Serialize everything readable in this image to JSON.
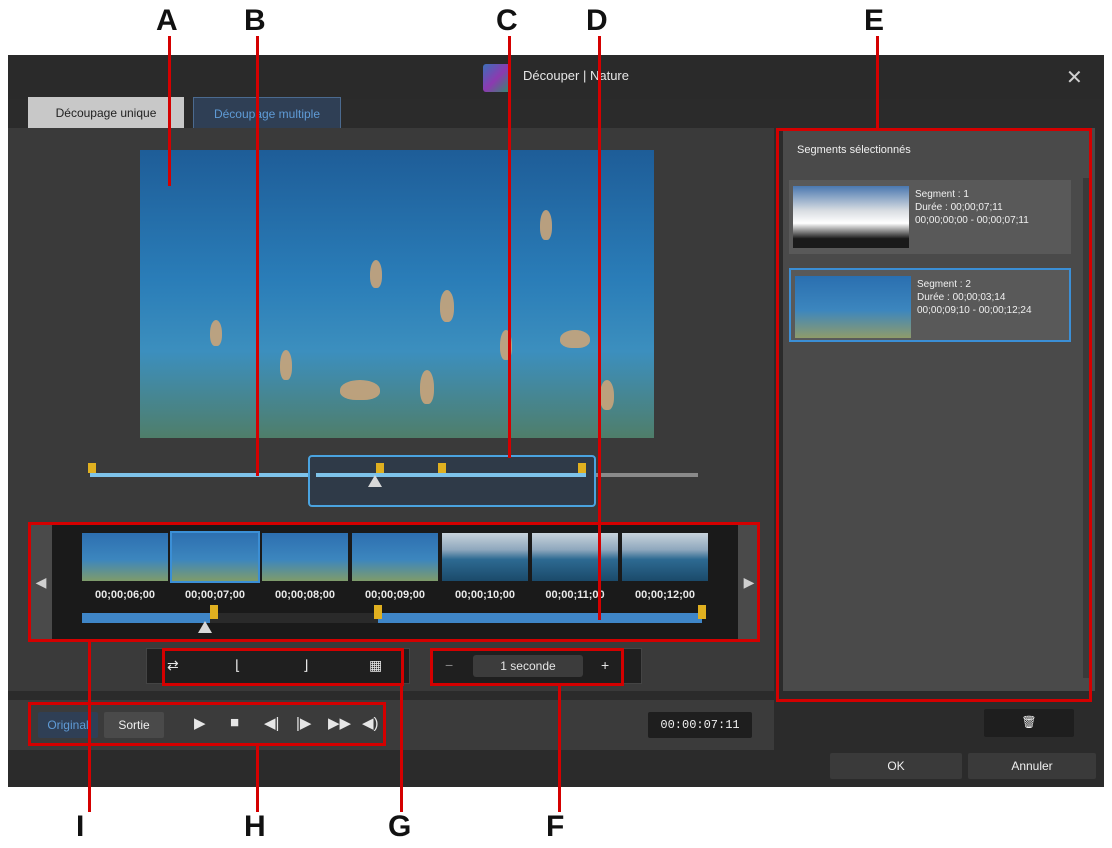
{
  "callouts": {
    "A": "A",
    "B": "B",
    "C": "C",
    "D": "D",
    "E": "E",
    "F": "F",
    "G": "G",
    "H": "H",
    "I": "I"
  },
  "window": {
    "title": "Découper | Nature",
    "close_glyph": "✕"
  },
  "tabs": [
    {
      "label": "Découpage unique",
      "active": true
    },
    {
      "label": "Découpage multiple",
      "active": false
    }
  ],
  "filmstrip": {
    "timecodes": [
      "00;00;06;00",
      "00;00;07;00",
      "00;00;08;00",
      "00;00;09;00",
      "00;00;10;00",
      "00;00;11;00",
      "00;00;12;00"
    ],
    "prev_glyph": "◀",
    "next_glyph": "▶"
  },
  "toolbar": {
    "icons": [
      "swap-in-out-icon",
      "mark-in-icon",
      "mark-out-icon",
      "multi-trim-icon"
    ],
    "zoom_out_glyph": "−",
    "zoom_in_glyph": "+",
    "zoom_level": "1 seconde"
  },
  "playback": {
    "original_label": "Original",
    "output_label": "Sortie",
    "timecode": "00:00:07:11",
    "icons": [
      "play-icon",
      "stop-icon",
      "prev-frame-icon",
      "next-frame-icon",
      "fast-forward-icon",
      "volume-icon"
    ]
  },
  "segments": {
    "header": "Segments sélectionnés",
    "items": [
      {
        "name": "Segment : 1",
        "duration": "Durée : 00;00;07;11",
        "range": "00;00;00;00 - 00;00;07;11"
      },
      {
        "name": "Segment : 2",
        "duration": "Durée : 00;00;03;14",
        "range": "00;00;09;10 - 00;00;12;24"
      }
    ]
  },
  "buttons": {
    "ok": "OK",
    "cancel": "Annuler",
    "delete_icon": "trash-icon"
  }
}
